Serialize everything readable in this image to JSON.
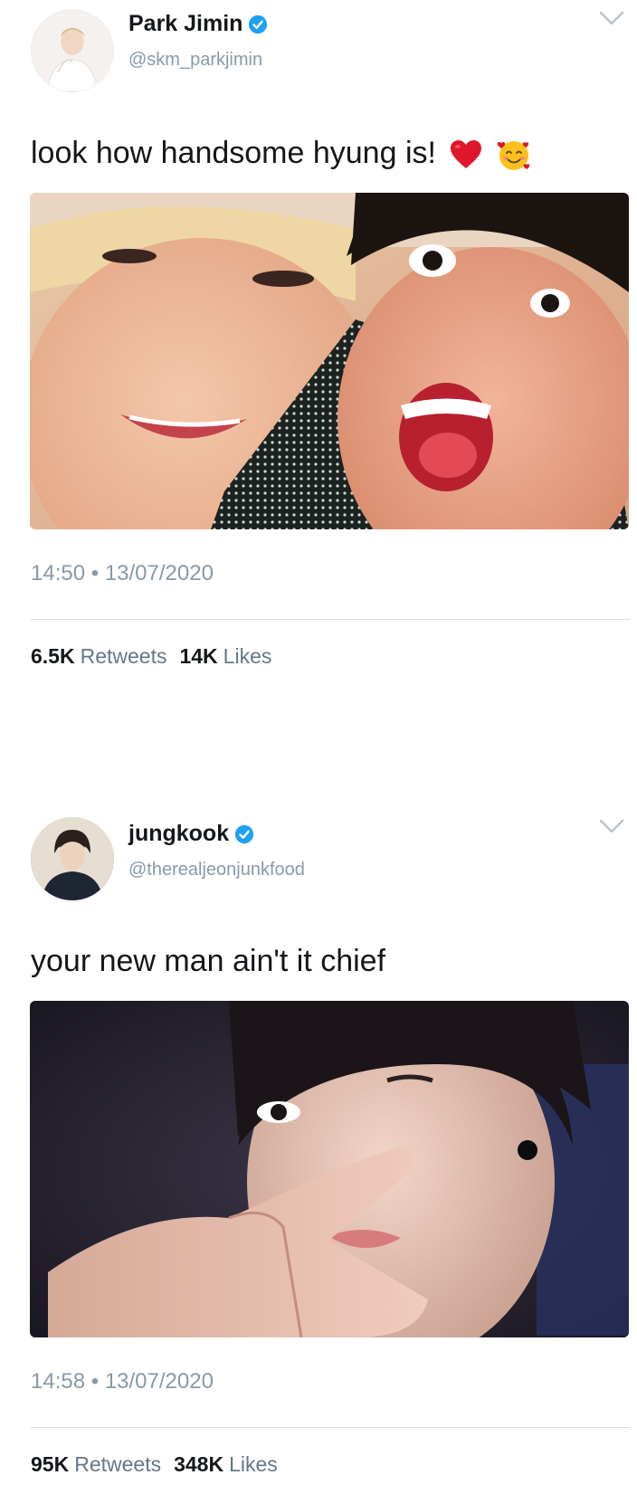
{
  "tweets": [
    {
      "display_name": "Park Jimin",
      "handle": "@skm_parkjimin",
      "verified": true,
      "text": "look how handsome hyung is!",
      "emojis": [
        "red-heart-emoji",
        "smiling-face-with-hearts-emoji"
      ],
      "time": "14:50",
      "date": "13/07/2020",
      "retweets_count": "6.5K",
      "retweets_label": "Retweets",
      "likes_count": "14K",
      "likes_label": "Likes"
    },
    {
      "display_name": "jungkook",
      "handle": "@therealjeonjunkfood",
      "verified": true,
      "text": "your new man ain't it chief",
      "emojis": [],
      "time": "14:58",
      "date": "13/07/2020",
      "retweets_count": "95K",
      "retweets_label": "Retweets",
      "likes_count": "348K",
      "likes_label": "Likes"
    }
  ],
  "separator": "•",
  "colors": {
    "verified_blue": "#1da1f2",
    "secondary_text": "#8899a6",
    "primary_text": "#14171a",
    "divider": "#d8dde1"
  }
}
